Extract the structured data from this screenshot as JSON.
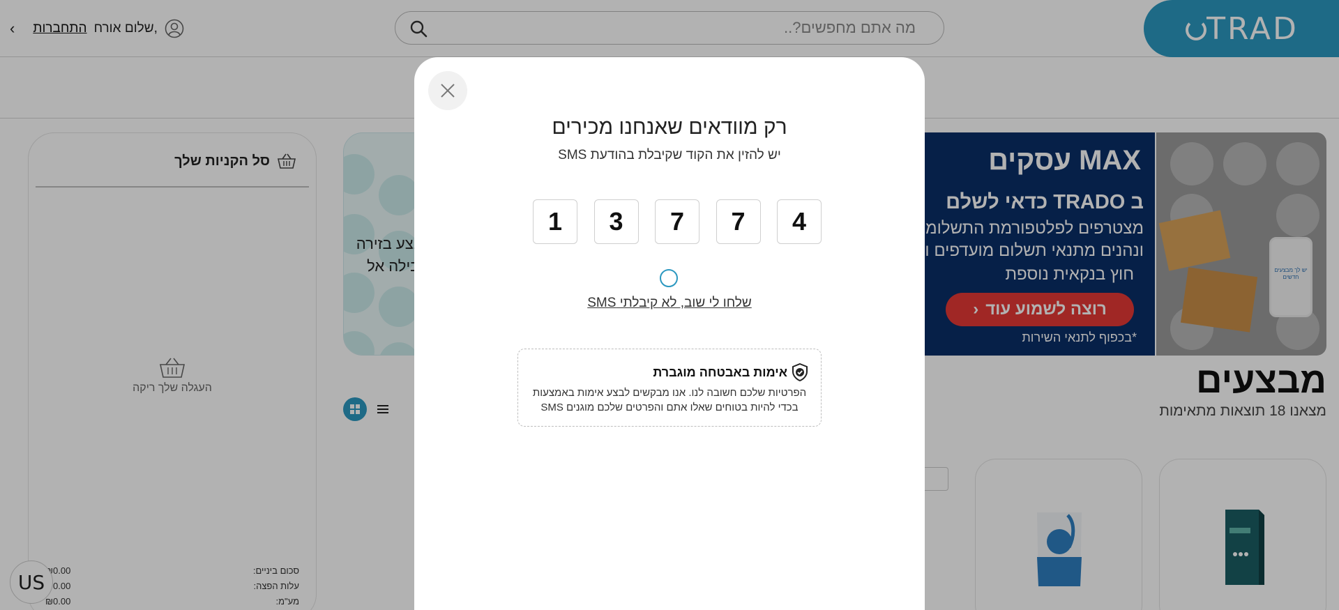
{
  "header": {
    "logo_text": "TRAD",
    "search_placeholder": "מה אתם מחפשים?..",
    "greeting": "שלום אורח,",
    "login_link": "התחברות"
  },
  "cart": {
    "title": "סל הקניות שלך",
    "empty_text": "העגלה שלך ריקה",
    "summary": [
      {
        "label": "סכום ביניים:",
        "value": "₪0.00"
      },
      {
        "label": "עלות הפצה:",
        "value": "₪0.00"
      },
      {
        "label": "מע\"מ:",
        "value": "₪0.00"
      }
    ]
  },
  "promo_card": {
    "line1": "מבצע בזירה",
    "line2": "הובילה אל"
  },
  "banner": {
    "brand": "MAX עסקים",
    "line1": "ב TRADO כדאי לשלם",
    "line2": "מצטרפים לפלטפורמת התשלומים",
    "line3": "ונהנים מתנאי תשלום מועדפים ומ",
    "line4": "חוץ בנקאית נוספת",
    "cta": "רוצה לשמוע עוד",
    "note": "*בכפוף לתנאי השירות",
    "phone_text": "יש לך מבצעים חדשים"
  },
  "deals": {
    "title": "מבצעים",
    "count": "מצאנו 18 תוצאות מתאימות"
  },
  "lang_button": "US",
  "modal": {
    "title": "רק מוודאים שאנחנו מכירים",
    "subtitle": "יש להזין את הקוד שקיבלת בהודעת SMS",
    "otp_digits": [
      "1",
      "3",
      "7",
      "7",
      "4"
    ],
    "resend_link": "שלחו לי שוב, לא קיבלתי SMS",
    "secure_title": "אימות באבטחה מוגברת",
    "secure_line1": "הפרטיות שלכם חשובה לנו. אנו מבקשים לבצע אימות באמצעות",
    "secure_line2": "בכדי להיות בטוחים שאלו אתם והפרטים שלכם מוגנים SMS"
  },
  "colors": {
    "brand": "#2b98c0",
    "banner_bg": "#0a2e68",
    "cta": "#e53935",
    "overlay": "rgba(0,0,0,0.3)"
  }
}
